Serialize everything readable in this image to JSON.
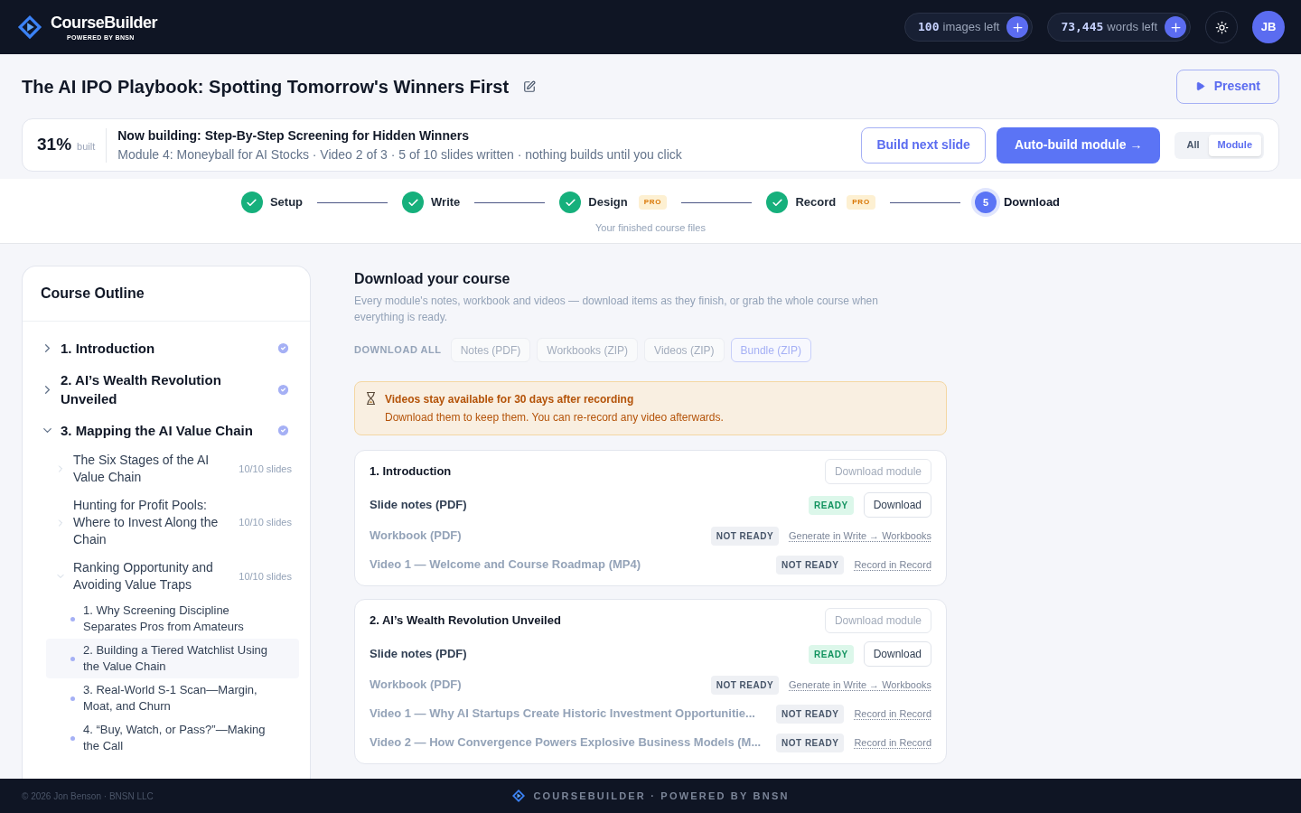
{
  "header": {
    "brand": "CourseBuilder",
    "tagline": "POWERED BY BNSN",
    "credits": [
      {
        "amount": "100",
        "label": "images left"
      },
      {
        "amount": "73,445",
        "label": "words left"
      }
    ],
    "avatar": "JB"
  },
  "course": {
    "title": "The AI IPO Playbook: Spotting Tomorrow's Winners First",
    "present_button": "Present"
  },
  "build": {
    "percent": "31%",
    "percent_label": "built",
    "heading": "Now building: Step-By-Step Screening for Hidden Winners",
    "detail": "Module 4: Moneyball for AI Stocks · Video 2 of 3 · 5 of 10 slides written · nothing builds until you click",
    "next_button": "Build next slide",
    "auto_button": "Auto-build module →",
    "scope": [
      {
        "label": "All",
        "selected": false
      },
      {
        "label": "Module",
        "selected": true
      }
    ]
  },
  "steps": [
    {
      "label": "Setup",
      "done": true,
      "selected": false
    },
    {
      "label": "Write",
      "done": true,
      "selected": false
    },
    {
      "label": "Design",
      "done": true,
      "selected": false,
      "badge": "PRO"
    },
    {
      "label": "Record",
      "done": true,
      "selected": false,
      "badge": "PRO"
    },
    {
      "label": "Download",
      "number": "5",
      "done": false,
      "selected": true
    }
  ],
  "step_caption": "Your finished course files",
  "outline": {
    "title": "Course Outline",
    "modules": [
      {
        "title": "1. Introduction",
        "expanded": false,
        "done": true
      },
      {
        "title": "2. AI’s Wealth Revolution Unveiled",
        "expanded": false,
        "done": true
      },
      {
        "title": "3. Mapping the AI Value Chain",
        "expanded": true,
        "done": true,
        "children": [
          {
            "title": "The Six Stages of the AI Value Chain",
            "count": "10/10 slides",
            "expanded": false
          },
          {
            "title": "Hunting for Profit Pools: Where to Invest Along the Chain",
            "count": "10/10 slides",
            "expanded": false
          },
          {
            "title": "Ranking Opportunity and Avoiding Value Traps",
            "count": "10/10 slides",
            "expanded": true,
            "children": [
              {
                "title": "1. Why Screening Discipline Separates Pros from Amateurs",
                "selected": false
              },
              {
                "title": "2. Building a Tiered Watchlist Using the Value Chain",
                "selected": true
              },
              {
                "title": "3. Real-World S-1 Scan—Margin, Moat, and Churn",
                "selected": false
              },
              {
                "title": "4. “Buy, Watch, or Pass?”—Making the Call",
                "selected": false
              }
            ]
          }
        ]
      }
    ]
  },
  "download": {
    "title": "Download your course",
    "description": "Every module's notes, workbook and videos — download items as they finish, or grab the whole course when everything is ready.",
    "all_label": "DOWNLOAD ALL",
    "all_buttons": [
      {
        "label": "Notes (PDF)",
        "kind": "plain"
      },
      {
        "label": "Workbooks (ZIP)",
        "kind": "plain"
      },
      {
        "label": "Videos (ZIP)",
        "kind": "plain"
      },
      {
        "label": "Bundle (ZIP)",
        "kind": "accent"
      }
    ],
    "notice": {
      "title": "Videos stay available for 30 days after recording",
      "body": "Download them to keep them. You can re-record any video afterwards."
    },
    "modules": [
      {
        "title": "1. Introduction",
        "button": "Download module",
        "items": [
          {
            "name": "Slide notes (PDF)",
            "ready": true,
            "status": "READY",
            "action": "Download"
          },
          {
            "name": "Workbook (PDF)",
            "ready": false,
            "status": "NOT READY",
            "action": "Generate in Write → Workbooks"
          },
          {
            "name": "Video 1 — Welcome and Course Roadmap (MP4)",
            "ready": false,
            "status": "NOT READY",
            "action": "Record in Record"
          }
        ]
      },
      {
        "title": "2. AI’s Wealth Revolution Unveiled",
        "button": "Download module",
        "items": [
          {
            "name": "Slide notes (PDF)",
            "ready": true,
            "status": "READY",
            "action": "Download"
          },
          {
            "name": "Workbook (PDF)",
            "ready": false,
            "status": "NOT READY",
            "action": "Generate in Write → Workbooks"
          },
          {
            "name": "Video 1 — Why AI Startups Create Historic Investment Opportunitie...",
            "ready": false,
            "status": "NOT READY",
            "action": "Record in Record"
          },
          {
            "name": "Video 2 — How Convergence Powers Explosive Business Models (M...",
            "ready": false,
            "status": "NOT READY",
            "action": "Record in Record"
          }
        ]
      }
    ]
  },
  "footer": {
    "copyright": "© 2026 Jon Benson · BNSN LLC",
    "brand": "COURSEBUILDER · POWERED BY BNSN"
  }
}
